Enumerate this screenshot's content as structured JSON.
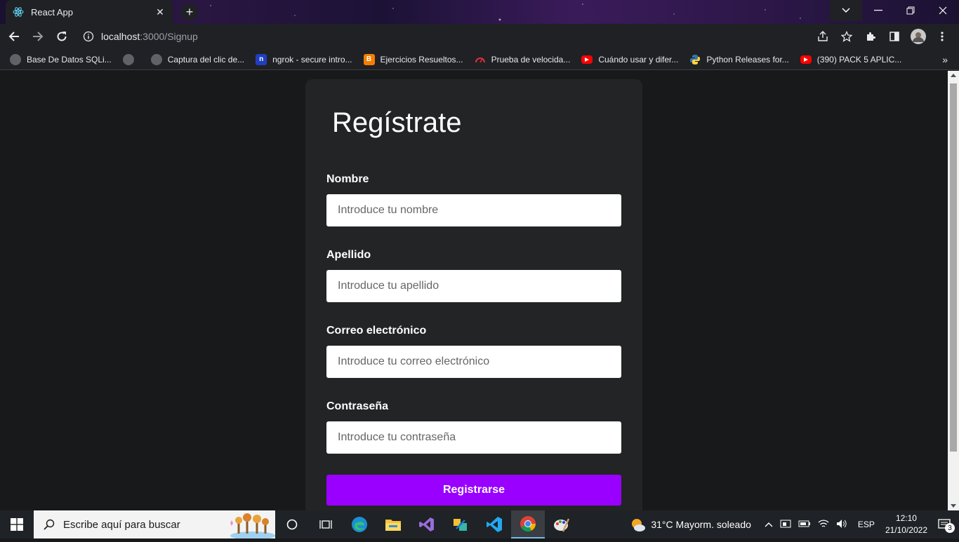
{
  "browser": {
    "tab_title": "React App",
    "tab_close": "✕",
    "new_tab": "+",
    "url_host": "localhost",
    "url_path": ":3000/Signup",
    "bookmarks": [
      "Base De Datos SQLi...",
      "Captura del clic de...",
      "ngrok - secure intro...",
      "Ejercicios Resueltos...",
      "Prueba de velocida...",
      "Cuándo usar y difer...",
      "Python Releases for...",
      "(390) PACK 5 APLIC..."
    ],
    "bookmarks_more": "»"
  },
  "form": {
    "title": "Regístrate",
    "fields": [
      {
        "label": "Nombre",
        "placeholder": "Introduce tu nombre"
      },
      {
        "label": "Apellido",
        "placeholder": "Introduce tu apellido"
      },
      {
        "label": "Correo electrónico",
        "placeholder": "Introduce tu correo electrónico"
      },
      {
        "label": "Contraseña",
        "placeholder": "Introduce tu contraseña"
      }
    ],
    "submit_label": "Registrarse"
  },
  "taskbar": {
    "search_placeholder": "Escribe aquí para buscar",
    "weather": "31°C  Mayorm. soleado",
    "language": "ESP",
    "time": "12:10",
    "date": "21/10/2022",
    "notifications": "3"
  },
  "colors": {
    "accent": "#9900ff",
    "page_bg": "#18191b",
    "card_bg": "#232426"
  }
}
